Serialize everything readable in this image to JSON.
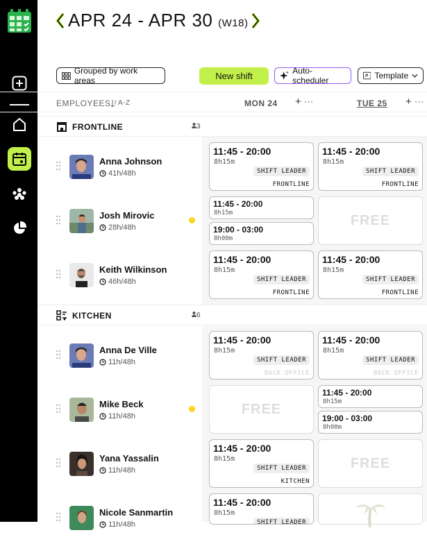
{
  "header": {
    "week_range": "APR 24 - APR 30",
    "week_number": "(W18)"
  },
  "toolbar": {
    "group_label": "Grouped by work areas",
    "new_shift_label": "New shift",
    "auto_scheduler_label": "Auto-scheduler",
    "template_label": "Template"
  },
  "columns": {
    "employees_label": "EMPLOYEES",
    "sort_label": "A-Z",
    "days": [
      {
        "label": "MON 24"
      },
      {
        "label": "TUE 25"
      }
    ]
  },
  "sections": [
    {
      "title": "FRONTLINE",
      "count": "3",
      "employees": [
        {
          "name": "Anna Johnson",
          "hours": "41h/48h",
          "dot": false,
          "mon": [
            {
              "time": "11:45 - 20:00",
              "duration": "8h15m",
              "badge": "SHIFT LEADER",
              "area": "FRONTLINE"
            }
          ],
          "tue": [
            {
              "time": "11:45 - 20:00",
              "duration": "8h15m",
              "badge": "SHIFT LEADER",
              "area": "FRONTLINE"
            }
          ]
        },
        {
          "name": "Josh Mirovic",
          "hours": "28h/48h",
          "dot": true,
          "mon": [
            {
              "time": "11:45 - 20:00",
              "duration": "8h15m"
            },
            {
              "time": "19:00 - 03:00",
              "duration": "8h00m"
            }
          ],
          "tue_free": "FREE"
        },
        {
          "name": "Keith Wilkinson",
          "hours": "46h/48h",
          "dot": false,
          "mon": [
            {
              "time": "11:45 - 20:00",
              "duration": "8h15m",
              "badge": "SHIFT LEADER",
              "area": "FRONTLINE"
            }
          ],
          "tue": [
            {
              "time": "11:45 - 20:00",
              "duration": "8h15m",
              "badge": "SHIFT LEADER",
              "area": "FRONTLINE"
            }
          ]
        }
      ]
    },
    {
      "title": "KITCHEN",
      "count": "6",
      "employees": [
        {
          "name": "Anna De Ville",
          "hours": "11h/48h",
          "dot": false,
          "mon": [
            {
              "time": "11:45 - 20:00",
              "duration": "8h15m",
              "badge": "SHIFT LEADER",
              "area": "BACK OFFICE"
            }
          ],
          "tue": [
            {
              "time": "11:45 - 20:00",
              "duration": "8h15m",
              "badge": "SHIFT LEADER",
              "area": "BACK OFFICE"
            }
          ]
        },
        {
          "name": "Mike Beck",
          "hours": "11h/48h",
          "dot": true,
          "mon_free": "FREE",
          "tue": [
            {
              "time": "11:45 - 20:00",
              "duration": "8h15m"
            },
            {
              "time": "19:00 - 03:00",
              "duration": "8h00m"
            }
          ]
        },
        {
          "name": "Yana Yassalin",
          "hours": "11h/48h",
          "dot": false,
          "mon": [
            {
              "time": "11:45 - 20:00",
              "duration": "8h15m",
              "badge": "SHIFT LEADER",
              "area": "KITCHEN"
            }
          ],
          "tue_free": "FREE"
        },
        {
          "name": "Nicole Sanmartin",
          "hours": "11h/48h",
          "dot": false,
          "mon": [
            {
              "time": "11:45 - 20:00",
              "duration": "8h15m",
              "badge": "SHIFT LEADER"
            }
          ]
        }
      ]
    }
  ],
  "colors": {
    "accent": "#c2f04a",
    "sidebar": "#000000",
    "warning_dot": "#ffd21f",
    "ai_border": "#8b5cf6"
  },
  "icons": [
    "calendar-logo-icon",
    "plus-square-icon",
    "home-icon",
    "calendar-icon",
    "team-icon",
    "pie-chart-icon",
    "drag-handle-icon",
    "clock-icon",
    "store-icon",
    "kitchen-icon",
    "sparkle-icon",
    "template-icon",
    "chevron-down-icon",
    "sort-icon",
    "plus-icon",
    "more-icon",
    "palm-tree-icon"
  ]
}
